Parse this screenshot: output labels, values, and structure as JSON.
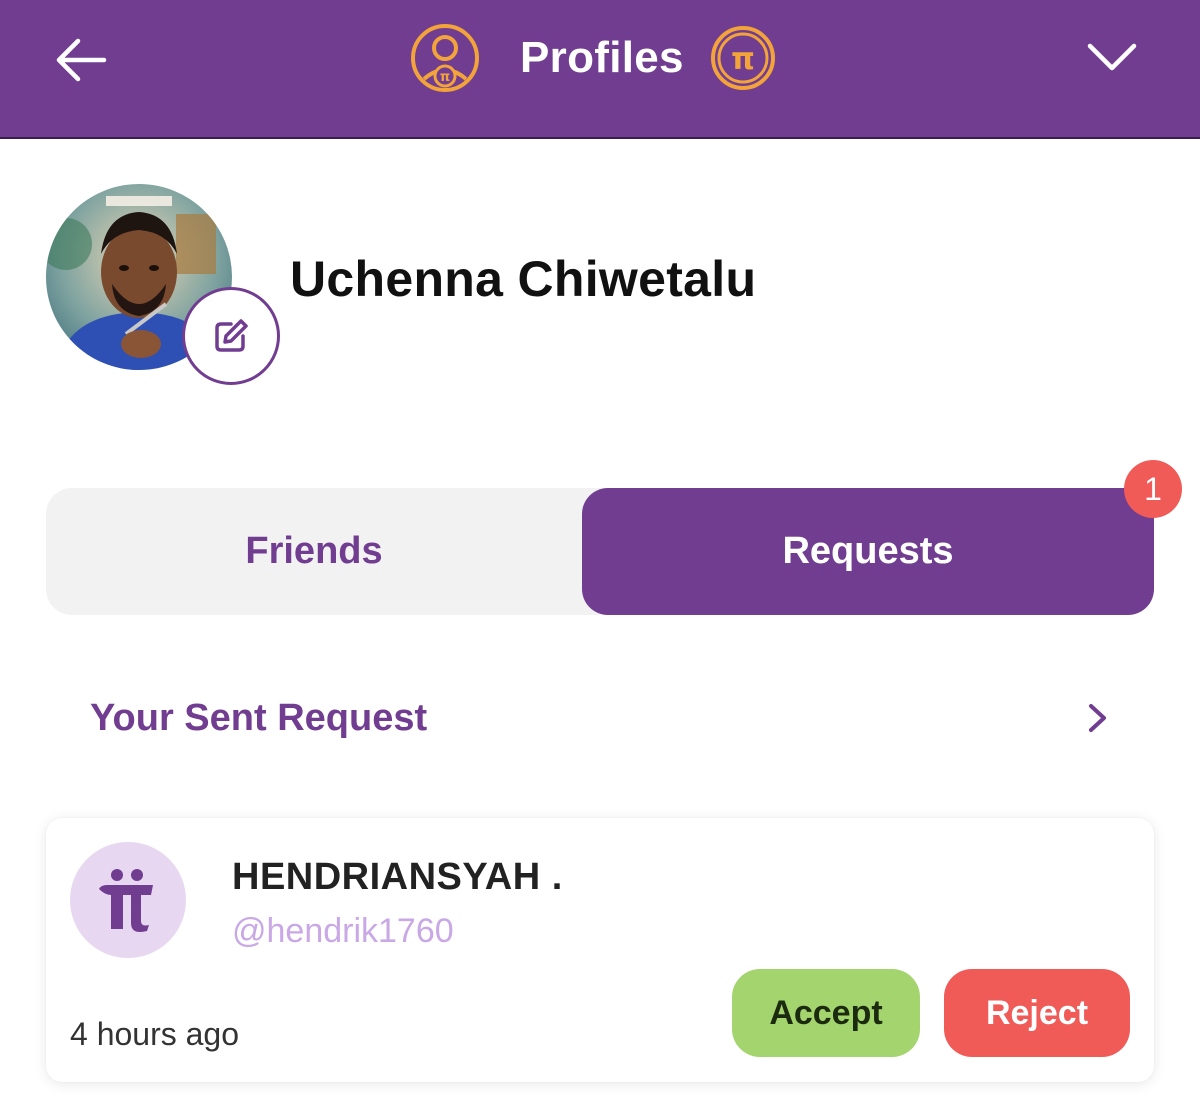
{
  "header": {
    "title": "Profiles",
    "back_icon": "arrow-left-icon",
    "profile_icon": "user-pi-badge-icon",
    "coin_icon": "pi-coin-icon",
    "dropdown_icon": "chevron-down-icon",
    "background_color": "#713d91",
    "accent_color": "#f2a33a"
  },
  "profile": {
    "name": "Uchenna Chiwetalu",
    "edit_icon": "edit-pencil-icon"
  },
  "tabs": [
    {
      "label": "Friends",
      "active": false
    },
    {
      "label": "Requests",
      "active": true,
      "badge": "1"
    }
  ],
  "sent_request": {
    "label": "Your Sent Request",
    "icon": "chevron-right-icon"
  },
  "request": {
    "name": "HENDRIANSYAH .",
    "handle": "@hendrik1760",
    "time": "4 hours ago",
    "accept_label": "Accept",
    "reject_label": "Reject",
    "accept_color": "#a3d46d",
    "reject_color": "#f05a57"
  }
}
